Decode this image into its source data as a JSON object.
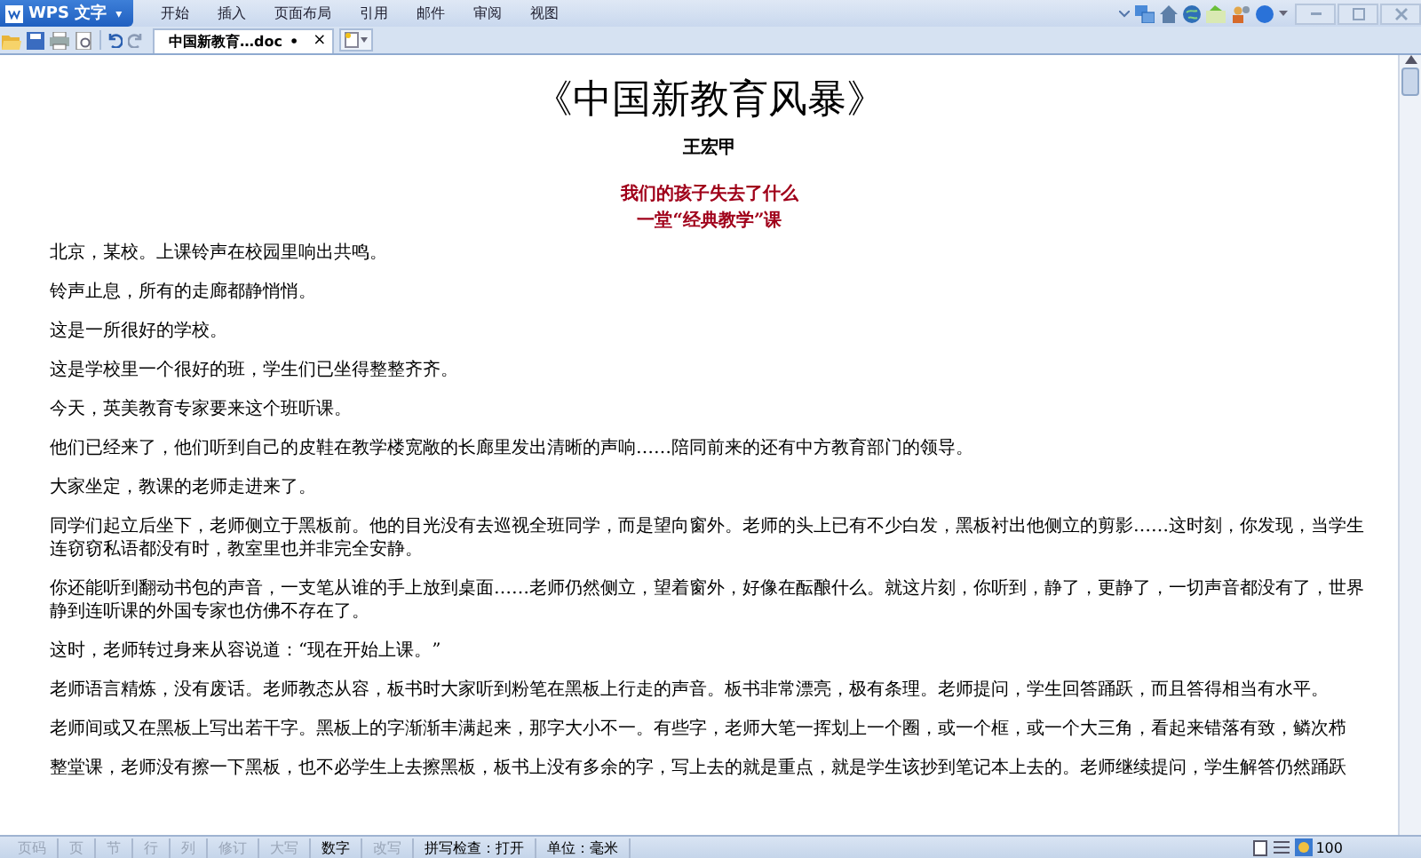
{
  "app_menu": {
    "label": "WPS 文字",
    "caret": "▾"
  },
  "menu": [
    {
      "label": "开始"
    },
    {
      "label": "插入"
    },
    {
      "label": "页面布局"
    },
    {
      "label": "引用"
    },
    {
      "label": "邮件"
    },
    {
      "label": "审阅"
    },
    {
      "label": "视图"
    }
  ],
  "document_tab": {
    "title": "中国新教育…doc",
    "modified_mark": "•",
    "close": "×"
  },
  "document": {
    "title": "《中国新教育风暴》",
    "author": "王宏甲",
    "headings": [
      "我们的孩子失去了什么",
      "一堂“经典教学”课"
    ],
    "paragraphs": [
      "北京，某校。上课铃声在校园里响出共鸣。",
      "铃声止息，所有的走廊都静悄悄。",
      "这是一所很好的学校。",
      "这是学校里一个很好的班，学生们已坐得整整齐齐。",
      "今天，英美教育专家要来这个班听课。",
      "他们已经来了，他们听到自己的皮鞋在教学楼宽敞的长廊里发出清晰的声响……陪同前来的还有中方教育部门的领导。",
      "大家坐定，教课的老师走进来了。",
      "同学们起立后坐下，老师侧立于黑板前。他的目光没有去巡视全班同学，而是望向窗外。老师的头上已有不少白发，黑板衬出他侧立的剪影……这时刻，你发现，当学生连窃窃私语都没有时，教室里也并非完全安静。",
      "你还能听到翻动书包的声音，一支笔从谁的手上放到桌面……老师仍然侧立，望着窗外，好像在酝酿什么。就这片刻，你听到，静了，更静了，一切声音都没有了，世界静到连听课的外国专家也仿佛不存在了。",
      "这时，老师转过身来从容说道：“现在开始上课。”",
      "老师语言精炼，没有废话。老师教态从容，板书时大家听到粉笔在黑板上行走的声音。板书非常漂亮，极有条理。老师提问，学生回答踊跃，而且答得相当有水平。",
      "老师间或又在黑板上写出若干字。黑板上的字渐渐丰满起来，那字大小不一。有些字，老师大笔一挥划上一个圈，或一个框，或一个大三角，看起来错落有致，鳞次栉",
      "整堂课，老师没有擦一下黑板，也不必学生上去擦黑板，板书上没有多余的字，写上去的就是重点，就是学生该抄到笔记本上去的。老师继续提问，学生解答仍然踊跃"
    ]
  },
  "status_bar": {
    "items": [
      {
        "label": "页码",
        "enabled": false
      },
      {
        "label": "页",
        "enabled": false
      },
      {
        "label": "节",
        "enabled": false
      },
      {
        "label": "行",
        "enabled": false
      },
      {
        "label": "列",
        "enabled": false
      },
      {
        "label": "修订",
        "enabled": false
      },
      {
        "label": "大写",
        "enabled": false
      },
      {
        "label": "数字",
        "enabled": true
      },
      {
        "label": "改写",
        "enabled": false
      }
    ],
    "spell_check": "拼写检查：打开",
    "unit": "单位：毫米",
    "zoom": "100"
  }
}
